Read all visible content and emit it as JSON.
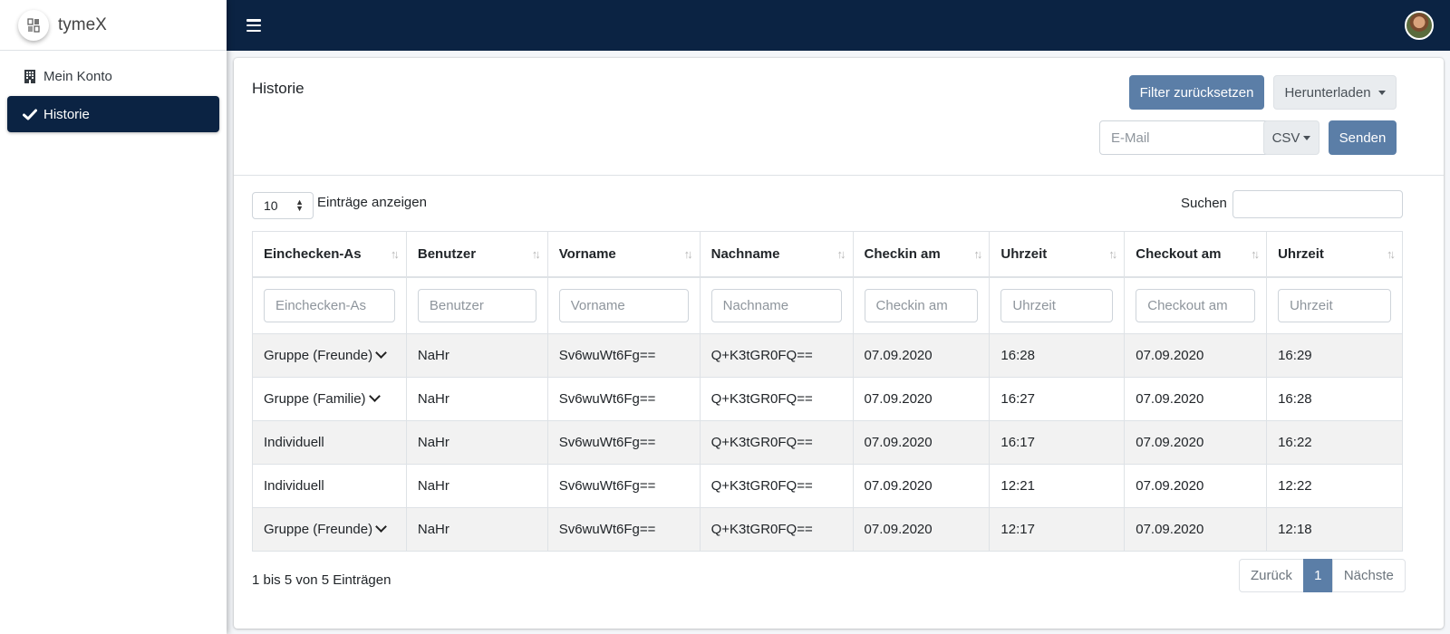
{
  "brand": {
    "name": "tymeX",
    "logo_text": "tymeX"
  },
  "sidebar": {
    "items": [
      {
        "label": "Mein Konto",
        "icon": "building-icon",
        "active": false
      },
      {
        "label": "Historie",
        "icon": "check-icon",
        "active": true
      }
    ]
  },
  "topbar": {
    "menu_icon": "hamburger-icon",
    "avatar": "user-avatar"
  },
  "card": {
    "title": "Historie",
    "reset_filter_label": "Filter zurücksetzen",
    "download_label": "Herunterladen",
    "email_placeholder": "E-Mail",
    "format_label": "CSV",
    "send_label": "Senden"
  },
  "controls": {
    "page_length": "10",
    "page_length_label": "Einträge anzeigen",
    "search_label": "Suchen",
    "search_value": ""
  },
  "table": {
    "columns": [
      "Einchecken-As",
      "Benutzer",
      "Vorname",
      "Nachname",
      "Checkin am",
      "Uhrzeit",
      "Checkout am",
      "Uhrzeit"
    ],
    "filter_placeholders": [
      "Einchecken-As",
      "Benutzer",
      "Vorname",
      "Nachname",
      "Checkin am",
      "Uhrzeit",
      "Checkout am",
      "Uhrzeit"
    ],
    "rows": [
      [
        "Gruppe (Freunde)",
        "NaHr",
        "Sv6wuWt6Fg==",
        "Q+K3tGR0FQ==",
        "07.09.2020",
        "16:28",
        "07.09.2020",
        "16:29"
      ],
      [
        "Gruppe (Familie)",
        "NaHr",
        "Sv6wuWt6Fg==",
        "Q+K3tGR0FQ==",
        "07.09.2020",
        "16:27",
        "07.09.2020",
        "16:28"
      ],
      [
        "Individuell",
        "NaHr",
        "Sv6wuWt6Fg==",
        "Q+K3tGR0FQ==",
        "07.09.2020",
        "16:17",
        "07.09.2020",
        "16:22"
      ],
      [
        "Individuell",
        "NaHr",
        "Sv6wuWt6Fg==",
        "Q+K3tGR0FQ==",
        "07.09.2020",
        "12:21",
        "07.09.2020",
        "12:22"
      ],
      [
        "Gruppe (Freunde)",
        "NaHr",
        "Sv6wuWt6Fg==",
        "Q+K3tGR0FQ==",
        "07.09.2020",
        "12:17",
        "07.09.2020",
        "12:18"
      ]
    ],
    "expandable_rows": [
      true,
      true,
      false,
      false,
      true
    ]
  },
  "footer": {
    "info": "1 bis 5 von 5 Einträgen",
    "prev_label": "Zurück",
    "current_page": "1",
    "next_label": "Nächste"
  },
  "colors": {
    "navy": "#0b2343",
    "accent": "#5b7ea7"
  }
}
